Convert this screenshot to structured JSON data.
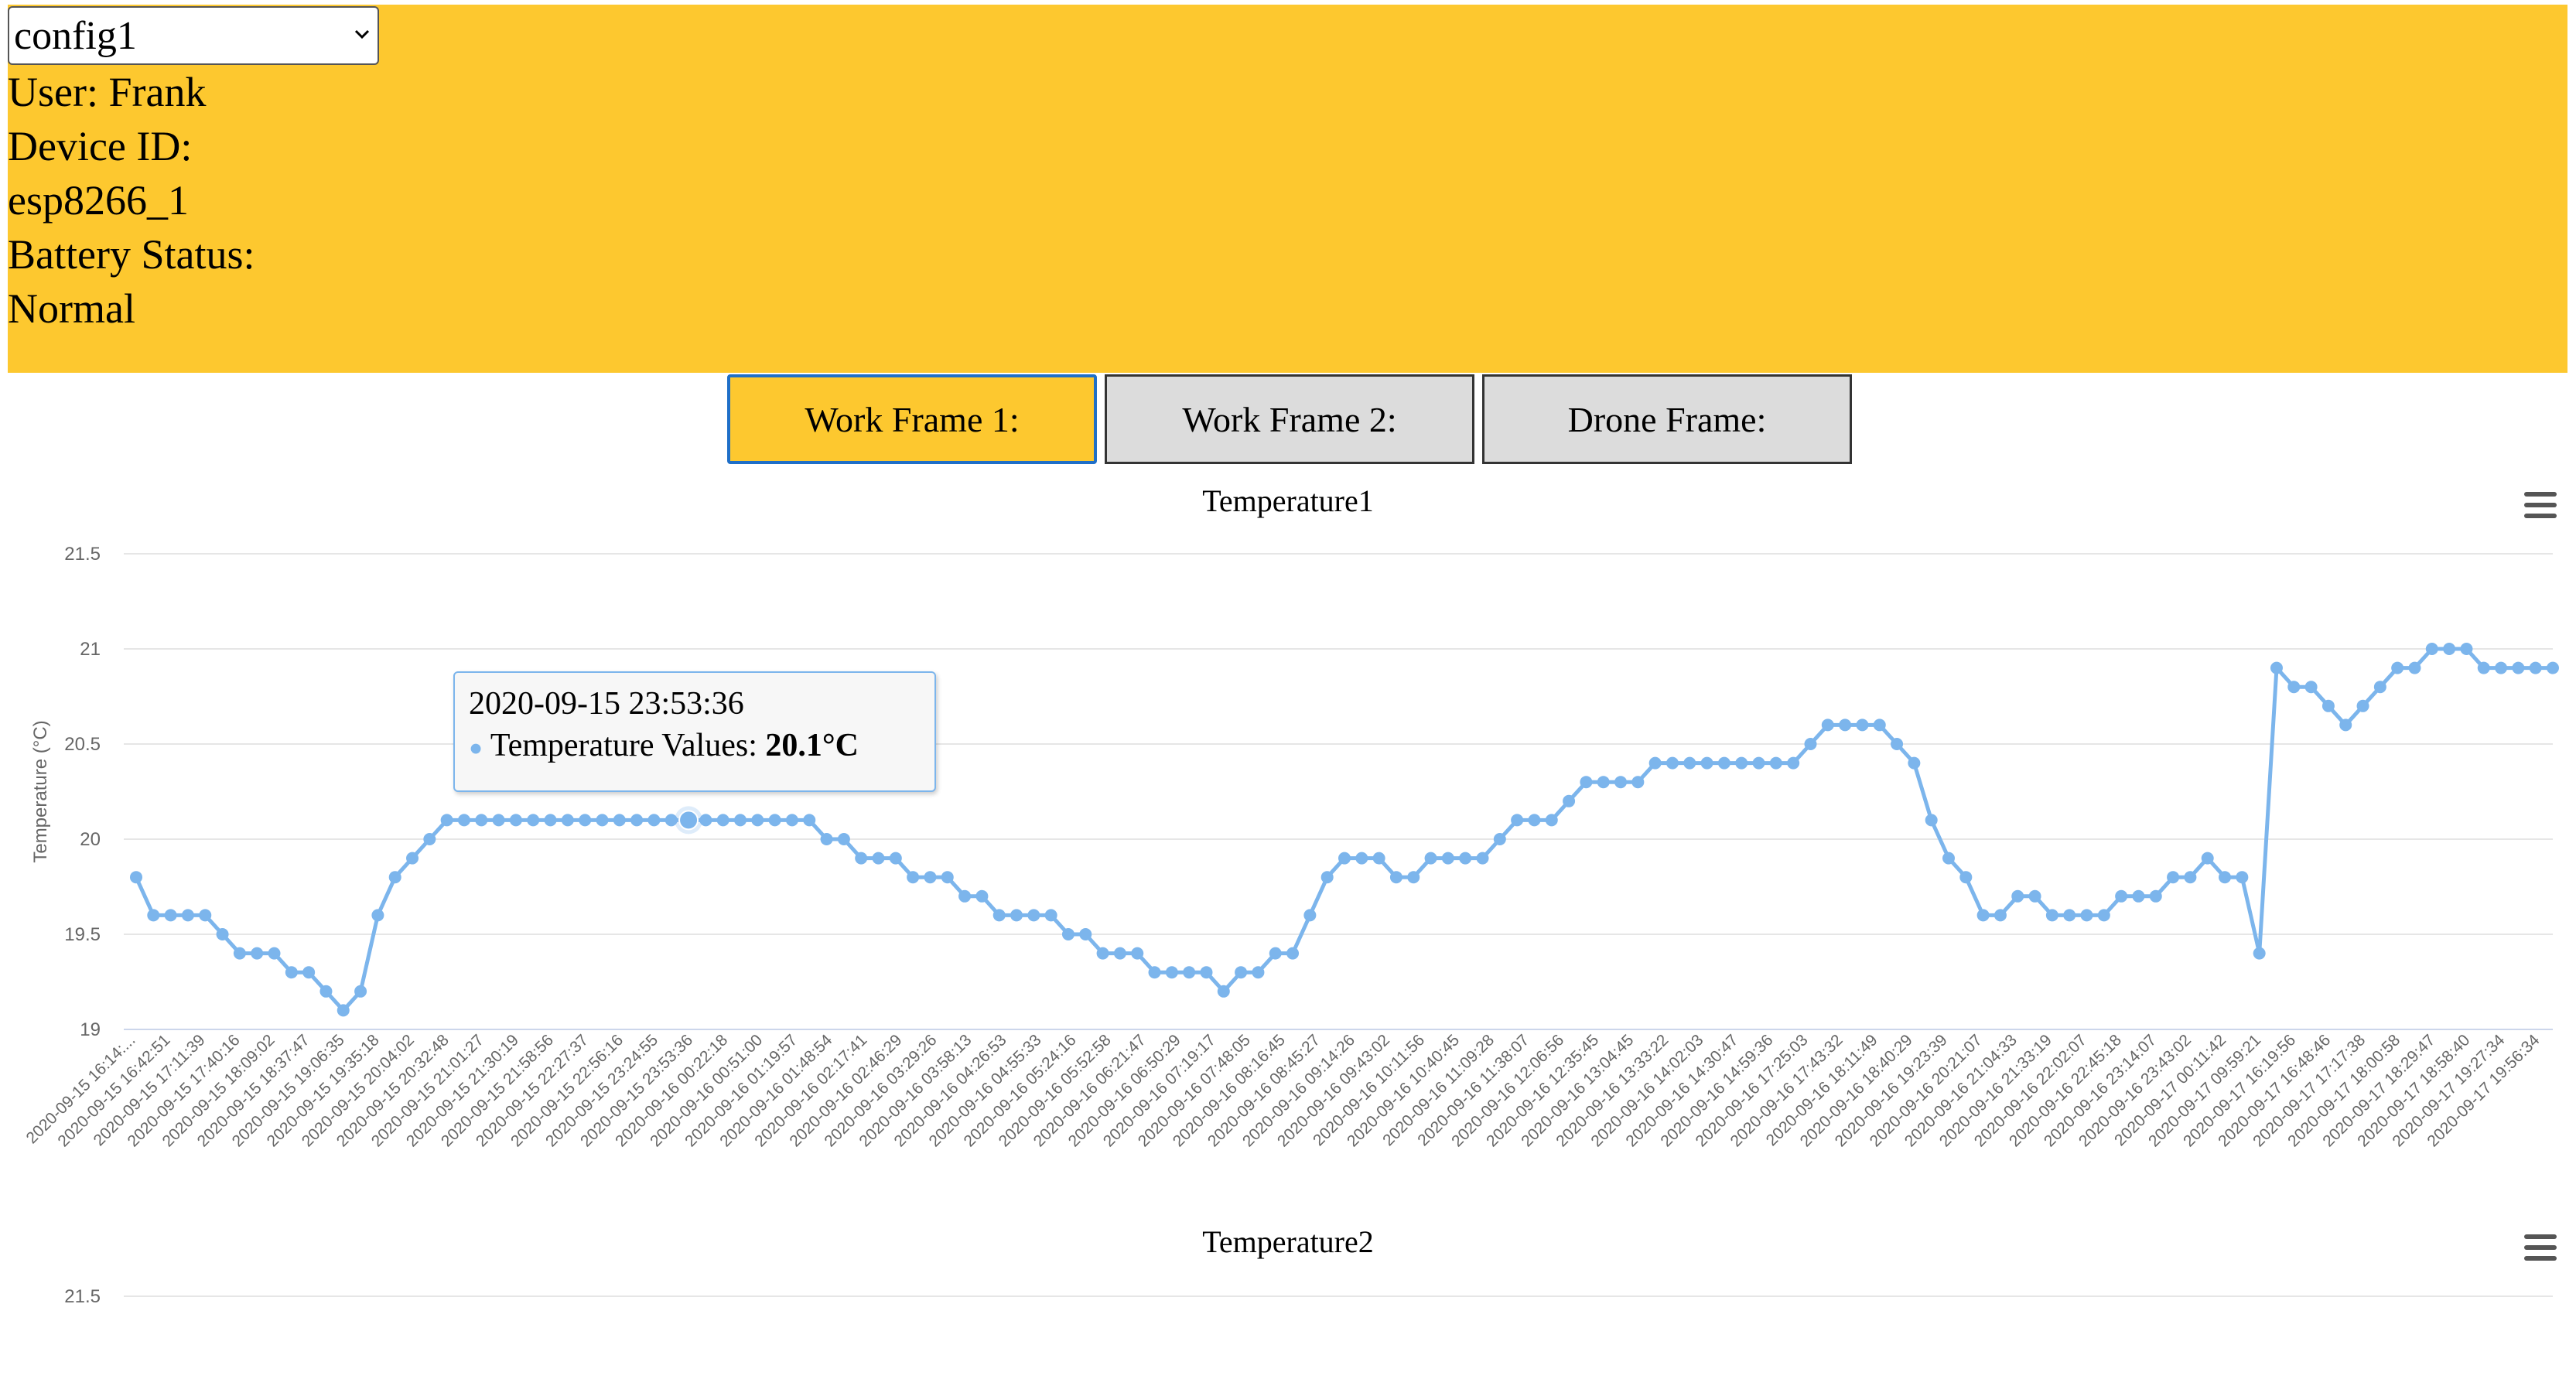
{
  "header": {
    "config_selected": "config1",
    "user_line": "User: Frank",
    "device_label": "Device ID:",
    "device_id": "esp8266_1",
    "battery_label": "Battery Status:",
    "battery_status": "Normal"
  },
  "frames": {
    "work_frame_1": "Work Frame 1:",
    "work_frame_2": "Work Frame 2:",
    "drone_frame": "Drone Frame:"
  },
  "colors": {
    "header_bg": "#fdc82f",
    "series": "#7cb5ec",
    "grid": "#e6e6e6"
  },
  "tooltip": {
    "date": "2020-09-15 23:53:36",
    "series_label": "Temperature Values:",
    "value": "20.1°C"
  },
  "chart_data": [
    {
      "type": "line",
      "title": "Temperature1",
      "ylabel": "Temperature (°C)",
      "xlabel": "",
      "ylim": [
        19,
        21.5
      ],
      "yticks": [
        19,
        19.5,
        20,
        20.5,
        21,
        21.5
      ],
      "grid": true,
      "legend": "none",
      "categories": [
        "2020-09-15 16:14:...",
        "2020-09-15 16:42:51",
        "2020-09-15 17:11:39",
        "2020-09-15 17:40:16",
        "2020-09-15 18:09:02",
        "2020-09-15 18:37:47",
        "2020-09-15 19:06:35",
        "2020-09-15 19:35:18",
        "2020-09-15 20:04:02",
        "2020-09-15 20:32:48",
        "2020-09-15 21:01:27",
        "2020-09-15 21:30:19",
        "2020-09-15 21:58:56",
        "2020-09-15 22:27:37",
        "2020-09-15 22:56:16",
        "2020-09-15 23:24:55",
        "2020-09-15 23:53:36",
        "2020-09-16 00:22:18",
        "2020-09-16 00:51:00",
        "2020-09-16 01:19:57",
        "2020-09-16 01:48:54",
        "2020-09-16 02:17:41",
        "2020-09-16 02:46:29",
        "2020-09-16 03:29:26",
        "2020-09-16 03:58:13",
        "2020-09-16 04:26:53",
        "2020-09-16 04:55:33",
        "2020-09-16 05:24:16",
        "2020-09-16 05:52:58",
        "2020-09-16 06:21:47",
        "2020-09-16 06:50:29",
        "2020-09-16 07:19:17",
        "2020-09-16 07:48:05",
        "2020-09-16 08:16:45",
        "2020-09-16 08:45:27",
        "2020-09-16 09:14:26",
        "2020-09-16 09:43:02",
        "2020-09-16 10:11:56",
        "2020-09-16 10:40:45",
        "2020-09-16 11:09:28",
        "2020-09-16 11:38:07",
        "2020-09-16 12:06:56",
        "2020-09-16 12:35:45",
        "2020-09-16 13:04:45",
        "2020-09-16 13:33:22",
        "2020-09-16 14:02:03",
        "2020-09-16 14:30:47",
        "2020-09-16 14:59:36",
        "2020-09-16 17:25:03",
        "2020-09-16 17:43:32",
        "2020-09-16 18:11:49",
        "2020-09-16 18:40:29",
        "2020-09-16 19:23:39",
        "2020-09-16 20:21:07",
        "2020-09-16 21:04:33",
        "2020-09-16 21:33:19",
        "2020-09-16 22:02:07",
        "2020-09-16 22:45:18",
        "2020-09-16 23:14:07",
        "2020-09-16 23:43:02",
        "2020-09-17 00:11:42",
        "2020-09-17 09:59:21",
        "2020-09-17 16:19:56",
        "2020-09-17 16:48:46",
        "2020-09-17 17:17:38",
        "2020-09-17 18:00:58",
        "2020-09-17 18:29:47",
        "2020-09-17 18:58:40",
        "2020-09-17 19:27:34",
        "2020-09-17 19:56:34"
      ],
      "values": [
        19.8,
        19.6,
        19.6,
        19.6,
        19.6,
        19.5,
        19.4,
        19.4,
        19.4,
        19.3,
        19.3,
        19.2,
        19.1,
        19.2,
        19.6,
        19.8,
        19.9,
        20.0,
        20.1,
        20.1,
        20.1,
        20.1,
        20.1,
        20.1,
        20.1,
        20.1,
        20.1,
        20.1,
        20.1,
        20.1,
        20.1,
        20.1,
        20.1,
        20.1,
        20.1,
        20.1,
        20.1,
        20.1,
        20.1,
        20.1,
        20.0,
        20.0,
        19.9,
        19.9,
        19.9,
        19.8,
        19.8,
        19.8,
        19.7,
        19.7,
        19.6,
        19.6,
        19.6,
        19.6,
        19.5,
        19.5,
        19.4,
        19.4,
        19.4,
        19.3,
        19.3,
        19.3,
        19.3,
        19.2,
        19.3,
        19.3,
        19.4,
        19.4,
        19.6,
        19.8,
        19.9,
        19.9,
        19.9,
        19.8,
        19.8,
        19.9,
        19.9,
        19.9,
        19.9,
        20.0,
        20.1,
        20.1,
        20.1,
        20.2,
        20.3,
        20.3,
        20.3,
        20.3,
        20.4,
        20.4,
        20.4,
        20.4,
        20.4,
        20.4,
        20.4,
        20.4,
        20.4,
        20.5,
        20.6,
        20.6,
        20.6,
        20.6,
        20.5,
        20.4,
        20.1,
        19.9,
        19.8,
        19.6,
        19.6,
        19.7,
        19.7,
        19.6,
        19.6,
        19.6,
        19.6,
        19.7,
        19.7,
        19.7,
        19.8,
        19.8,
        19.9,
        19.8,
        19.8,
        19.4,
        20.9,
        20.8,
        20.8,
        20.7,
        20.6,
        20.7,
        20.8,
        20.9,
        20.9,
        21.0,
        21.0,
        21.0,
        20.9,
        20.9,
        20.9,
        20.9,
        20.9
      ],
      "highlight_index": 32
    },
    {
      "type": "line",
      "title": "Temperature2",
      "yticks": [
        21.5
      ],
      "grid": true
    }
  ]
}
